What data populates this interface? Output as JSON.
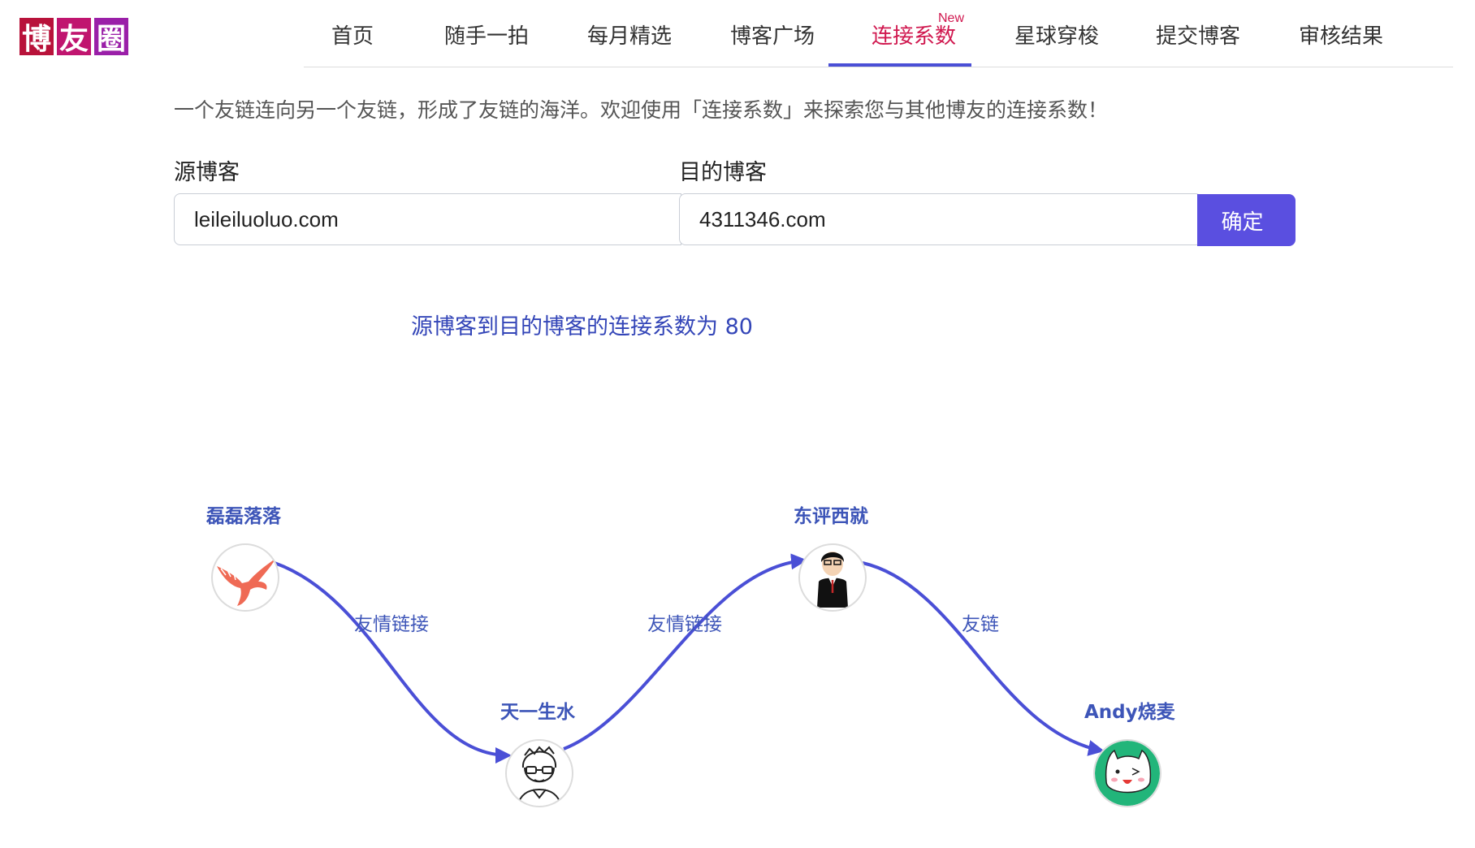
{
  "logo": {
    "chars": [
      "博",
      "友",
      "圈"
    ]
  },
  "nav": {
    "items": [
      {
        "label": "首页"
      },
      {
        "label": "随手一拍"
      },
      {
        "label": "每月精选"
      },
      {
        "label": "博客广场"
      },
      {
        "label": "连接系数",
        "active": true,
        "badge": "New"
      },
      {
        "label": "星球穿梭"
      },
      {
        "label": "提交博客"
      },
      {
        "label": "审核结果"
      }
    ]
  },
  "intro": "一个友链连向另一个友链，形成了友链的海洋。欢迎使用「连接系数」来探索您与其他博友的连接系数！",
  "form": {
    "source_label": "源博客",
    "source_value": "leileiluoluo.com",
    "target_label": "目的博客",
    "target_value": "4311346.com",
    "confirm_label": "确定"
  },
  "result_text": "源博客到目的博客的连接系数为 80",
  "graph": {
    "nodes": [
      {
        "name": "磊磊落落",
        "avatar": "eagle-icon"
      },
      {
        "name": "天一生水",
        "avatar": "glasses-man-icon"
      },
      {
        "name": "东评西就",
        "avatar": "suit-man-icon"
      },
      {
        "name": "Andy烧麦",
        "avatar": "cat-icon"
      }
    ],
    "edges": [
      {
        "label": "友情链接"
      },
      {
        "label": "友情链接"
      },
      {
        "label": "友链"
      }
    ],
    "colors": {
      "edge": "#4a4fd6",
      "label": "#3d55b8"
    }
  }
}
